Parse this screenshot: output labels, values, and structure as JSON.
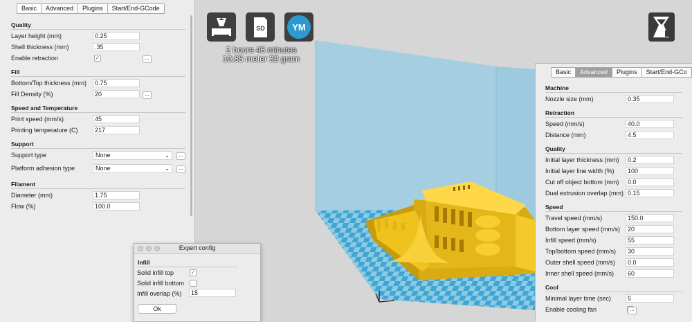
{
  "left_panel": {
    "tabs": [
      "Basic",
      "Advanced",
      "Plugins",
      "Start/End-GCode"
    ],
    "sections": [
      {
        "title": "Quality",
        "rows": [
          {
            "label": "Layer height (mm)",
            "type": "input",
            "value": "0.25"
          },
          {
            "label": "Shell thickness (mm)",
            "type": "input",
            "value": ".35"
          },
          {
            "label": "Enable retraction",
            "type": "checkbox",
            "checked": true,
            "extra": true
          }
        ]
      },
      {
        "title": "Fill",
        "rows": [
          {
            "label": "Bottom/Top thickness (mm)",
            "type": "input",
            "value": "0.75"
          },
          {
            "label": "Fill Density (%)",
            "type": "input",
            "value": "20",
            "extra": true
          }
        ]
      },
      {
        "title": "Speed and Temperature",
        "rows": [
          {
            "label": "Print speed (mm/s)",
            "type": "input",
            "value": "45"
          },
          {
            "label": "Printing temperature (C)",
            "type": "input",
            "value": "217"
          }
        ]
      },
      {
        "title": "Support",
        "rows": [
          {
            "label": "Support type",
            "type": "select",
            "value": "None",
            "extra": true
          },
          {
            "label": "Platform adhesion type",
            "type": "select",
            "value": "None",
            "extra": true
          }
        ]
      },
      {
        "title": "Filament",
        "rows": [
          {
            "label": "Diameter (mm)",
            "type": "input",
            "value": "1.75"
          },
          {
            "label": "Flow (%)",
            "type": "input",
            "value": "100.0"
          }
        ]
      }
    ]
  },
  "toolbar": {
    "sd_label": "SD",
    "ym_label": "YM",
    "info_time": "2 hours 45 minutes",
    "info_material": "10.85 meter 32 gram"
  },
  "right_panel": {
    "tabs": [
      "Basic",
      "Advanced",
      "Plugins",
      "Start/End-GCo"
    ],
    "sections": [
      {
        "title": "Machine",
        "rows": [
          {
            "label": "Nozzle size (mm)",
            "type": "input",
            "value": "0.35"
          }
        ]
      },
      {
        "title": "Retraction",
        "rows": [
          {
            "label": "Speed (mm/s)",
            "type": "input",
            "value": "40.0"
          },
          {
            "label": "Distance (mm)",
            "type": "input",
            "value": "4.5"
          }
        ]
      },
      {
        "title": "Quality",
        "rows": [
          {
            "label": "Initial layer thickness (mm)",
            "type": "input",
            "value": "0.2"
          },
          {
            "label": "Initial layer line width (%)",
            "type": "input",
            "value": "100"
          },
          {
            "label": "Cut off object bottom (mm)",
            "type": "input",
            "value": "0.0"
          },
          {
            "label": "Dual extrusion overlap (mm)",
            "type": "input",
            "value": "0.15"
          }
        ]
      },
      {
        "title": "Speed",
        "rows": [
          {
            "label": "Travel speed (mm/s)",
            "type": "input",
            "value": "150.0"
          },
          {
            "label": "Bottom layer speed (mm/s)",
            "type": "input",
            "value": "20"
          },
          {
            "label": "Infill speed (mm/s)",
            "type": "input",
            "value": "55"
          },
          {
            "label": "Top/bottom speed (mm/s)",
            "type": "input",
            "value": "30"
          },
          {
            "label": "Outer shell speed (mm/s)",
            "type": "input",
            "value": "0.0"
          },
          {
            "label": "Inner shell speed (mm/s)",
            "type": "input",
            "value": "60"
          }
        ]
      },
      {
        "title": "Cool",
        "rows": [
          {
            "label": "Minimal layer time (sec)",
            "type": "input",
            "value": "5"
          },
          {
            "label": "Enable cooling fan",
            "type": "checkbox",
            "checked": true,
            "extra": true
          }
        ]
      }
    ]
  },
  "dialog": {
    "title": "Expert config",
    "section": "Infill",
    "solid_top_label": "Solid infill top",
    "solid_top_checked": true,
    "solid_bottom_label": "Solid infill bottom",
    "solid_bottom_checked": false,
    "overlap_label": "Infill overlap (%)",
    "overlap_value": "15",
    "ok_label": "Ok"
  },
  "colors": {
    "build_volume": "#9fcbe0",
    "floor_light": "#8fcde4",
    "floor_dark": "#3fa4d1",
    "model": "#f2c524",
    "model_shadow": "#c99a0c"
  }
}
